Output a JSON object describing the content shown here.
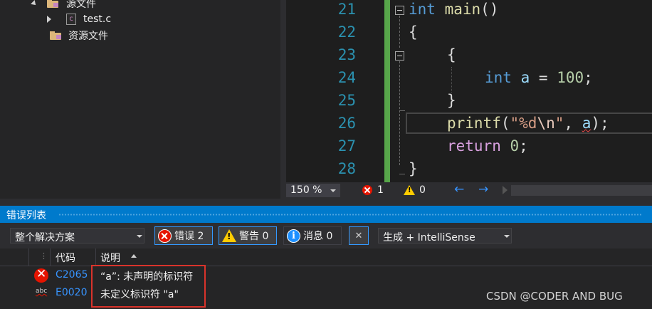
{
  "solution_explorer": {
    "items": [
      {
        "label": "源文件",
        "kind": "filter"
      },
      {
        "label": "test.c",
        "kind": "file"
      },
      {
        "label": "资源文件",
        "kind": "filter"
      }
    ]
  },
  "editor": {
    "line_numbers": [
      "21",
      "22",
      "23",
      "24",
      "25",
      "26",
      "27",
      "28"
    ],
    "lines": {
      "l21": {
        "kw": "int",
        "fn": "main",
        "rest": "()"
      },
      "l22": {
        "text": "{"
      },
      "l23": {
        "text": "{"
      },
      "l24": {
        "kw": "int",
        "var": "a",
        "eq": " = ",
        "num": "100",
        "end": ";"
      },
      "l25": {
        "text": "}"
      },
      "l26": {
        "fn": "printf",
        "open": "(",
        "str1": "\"%d",
        "esc": "\\n",
        "str2": "\"",
        "comma": ", ",
        "var": "a",
        "close": ");"
      },
      "l27": {
        "kw": "return",
        "sp": " ",
        "num": "0",
        "end": ";"
      },
      "l28": {
        "text": "}"
      }
    }
  },
  "editor_status": {
    "zoom": "150 %",
    "errors": "1",
    "warnings": "0"
  },
  "error_list": {
    "title": "错误列表",
    "scope": "整个解决方案",
    "errors_btn": "错误 2",
    "warnings_btn": "警告 0",
    "messages_btn": "消息 0",
    "source": "生成 + IntelliSense",
    "col_code": "代码",
    "col_desc": "说明",
    "rows": [
      {
        "code": "C2065",
        "desc": "“a”: 未声明的标识符",
        "icon": "error-icon"
      },
      {
        "code": "E0020",
        "desc": "未定义标识符 \"a\"",
        "icon": "intellisense-abc-icon"
      }
    ]
  },
  "watermark": "CSDN @CODER AND BUG",
  "colors": {
    "accent": "#007acc",
    "error": "#e51400",
    "warning": "#ffcc00",
    "highlight_box": "#d9332b"
  }
}
